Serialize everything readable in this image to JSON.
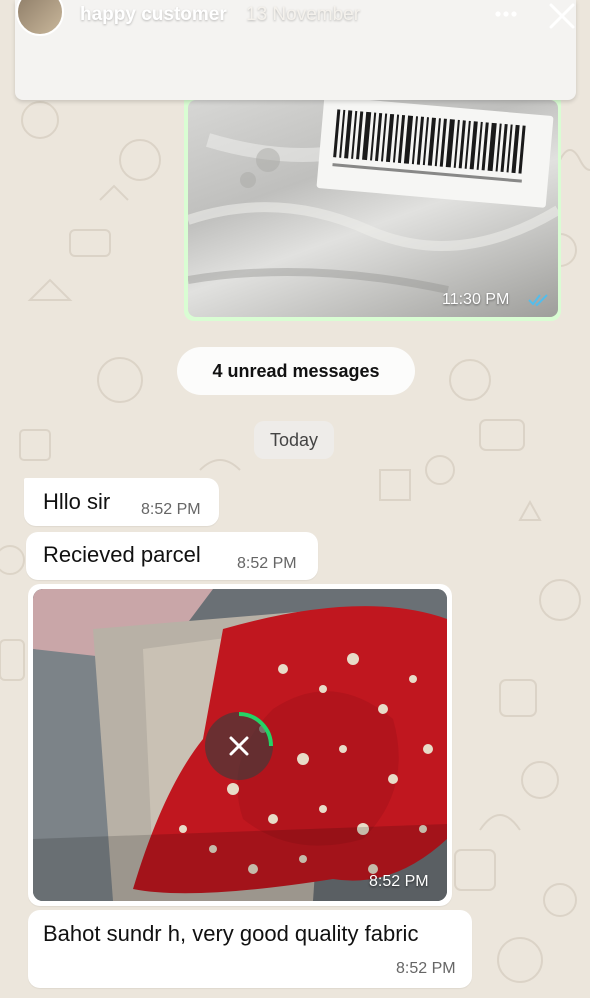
{
  "story": {
    "name": "happy customer",
    "date": "13 November"
  },
  "outgoing_image": {
    "time": "11:30 PM",
    "status_icon": "double-check-icon"
  },
  "unread_label": "4 unread messages",
  "date_divider": "Today",
  "messages": [
    {
      "text": "Hllo sir",
      "time": "8:52 PM"
    },
    {
      "text": "Recieved parcel",
      "time": "8:52 PM"
    },
    {
      "image": true,
      "time": "8:52 PM",
      "download_icon": "cancel-download-icon"
    },
    {
      "text": "Bahot sundr h, very good quality fabric",
      "time": "8:52 PM"
    }
  ],
  "colors": {
    "wallpaper": "#ece6dc",
    "outgoing_bubble": "#d9fdd3",
    "incoming_bubble": "#ffffff",
    "progress_ring": "#25d366",
    "tick_blue": "#53bdeb"
  }
}
